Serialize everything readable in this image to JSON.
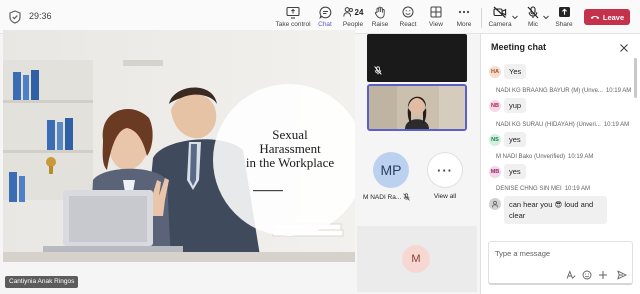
{
  "meeting": {
    "timer": "29:36"
  },
  "toolbar": {
    "take_control": "Take control",
    "chat": "Chat",
    "people": "People",
    "people_count": "24",
    "raise": "Raise",
    "react": "React",
    "view": "View",
    "more": "More",
    "camera": "Camera",
    "mic": "Mic",
    "share": "Share",
    "leave": "Leave"
  },
  "stage": {
    "slide": {
      "line1": "Sexual",
      "line2": "Harassment",
      "line3": "in the Workplace"
    },
    "presenter_name": "Cantiynia Anak Ringos",
    "participants": [
      {
        "initials": "MP",
        "name": "M NADI Ra..."
      },
      {
        "initials": "M"
      }
    ],
    "view_all": "View all",
    "view_all_icon": "···"
  },
  "chat": {
    "title": "Meeting chat",
    "messages": [
      {
        "initials": "HA",
        "author": "",
        "time": "",
        "text": "Yes",
        "avatar_bg": "#f6dccd",
        "avatar_fg": "#a0502a"
      },
      {
        "initials": "NB",
        "author": "NADI KG BRAANG BAYUR (M) (Unve...",
        "time": "10:19 AM",
        "text": "yup",
        "avatar_bg": "#f9d7e6",
        "avatar_fg": "#a3295b"
      },
      {
        "initials": "NS",
        "author": "NADI KG SURAU (HIDAYAH) (Unveri...",
        "time": "10:19 AM",
        "text": "yes",
        "avatar_bg": "#d3efe0",
        "avatar_fg": "#1f7a4d"
      },
      {
        "initials": "MB",
        "author": "M NADI Bako (Unverified)",
        "time": "10:19 AM",
        "text": "yes",
        "avatar_bg": "#f4d5e8",
        "avatar_fg": "#8e2f6c"
      },
      {
        "initials": "",
        "author": "DENISE CHNG SIN MEI",
        "time": "10:19 AM",
        "text_part1": "can hear you",
        "emoji": "😎",
        "text_part2": "loud and",
        "text_line2": "clear",
        "avatar_bg": "#d1d1d1",
        "avatar_fg": "#616161"
      }
    ],
    "compose_placeholder": "Type a message"
  },
  "colors": {
    "accent": "#5b5fc7",
    "leave": "#c4314b"
  },
  "icons": [
    "shield-icon",
    "share-screen-icon",
    "chat-icon",
    "people-icon",
    "hand-icon",
    "emoji-icon",
    "grid-icon",
    "more-icon",
    "camera-off-icon",
    "mic-off-icon",
    "share-icon",
    "phone-icon",
    "close-icon",
    "format-icon",
    "emoji-icon",
    "plus-icon",
    "send-icon"
  ]
}
